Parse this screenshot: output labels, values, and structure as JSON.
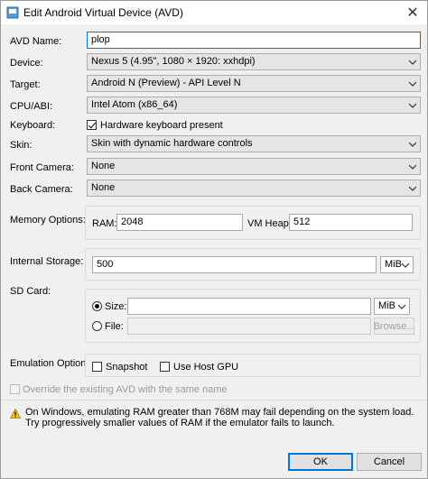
{
  "window": {
    "title": "Edit Android Virtual Device (AVD)"
  },
  "labels": {
    "avd_name": "AVD Name:",
    "device": "Device:",
    "target": "Target:",
    "cpu_abi": "CPU/ABI:",
    "keyboard": "Keyboard:",
    "skin": "Skin:",
    "front_camera": "Front Camera:",
    "back_camera": "Back Camera:",
    "memory_options": "Memory Options:",
    "internal_storage": "Internal Storage:",
    "sd_card": "SD Card:",
    "emulation_options": "Emulation Options:"
  },
  "fields": {
    "avd_name": "plop",
    "device": "Nexus 5 (4.95\", 1080 × 1920: xxhdpi)",
    "target": "Android N (Preview) - API Level N",
    "cpu_abi": "Intel Atom (x86_64)",
    "keyboard_checkbox": "Hardware keyboard present",
    "skin": "Skin with dynamic hardware controls",
    "front_camera": "None",
    "back_camera": "None"
  },
  "memory": {
    "ram_label": "RAM:",
    "ram_value": "2048",
    "vmheap_label": "VM Heap:",
    "vmheap_value": "512"
  },
  "storage": {
    "value": "500",
    "unit": "MiB"
  },
  "sdcard": {
    "size_label": "Size:",
    "size_value": "",
    "size_unit": "MiB",
    "file_label": "File:",
    "file_value": "",
    "browse": "Browse..."
  },
  "emulation": {
    "snapshot": "Snapshot",
    "host_gpu": "Use Host GPU"
  },
  "override": "Override the existing AVD with the same name",
  "warning": "On Windows, emulating RAM greater than 768M may fail depending on the system load. Try progressively smaller values of RAM if the emulator fails to launch.",
  "buttons": {
    "ok": "OK",
    "cancel": "Cancel"
  }
}
